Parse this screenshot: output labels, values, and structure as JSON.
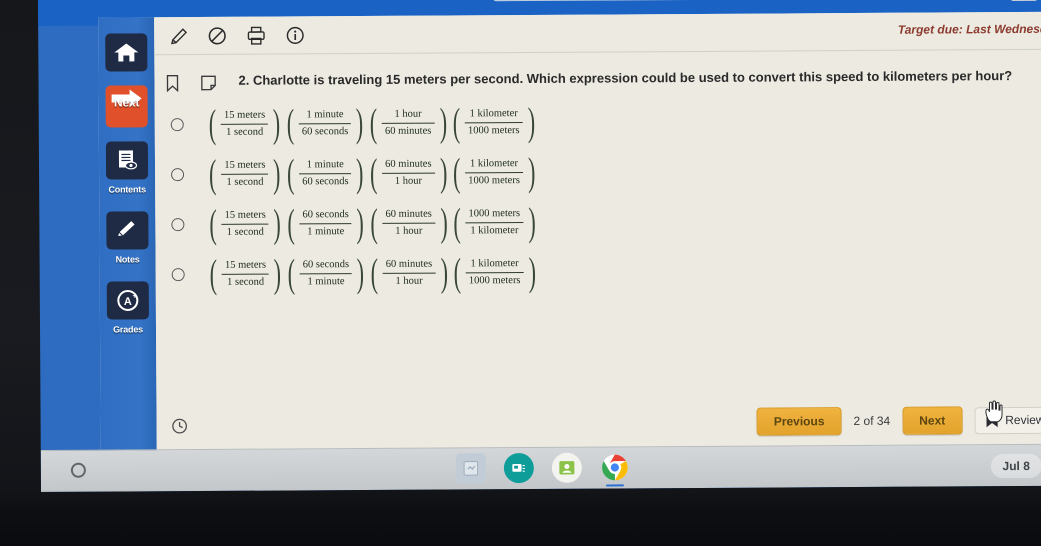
{
  "window": {
    "target_due": "Target due: Last Wednesd"
  },
  "nav_rail": {
    "items": [
      {
        "label": "",
        "icon": "home-icon",
        "name": "home"
      },
      {
        "label": "Next",
        "icon": "arrow-right-icon",
        "name": "next"
      },
      {
        "label": "Contents",
        "icon": "contents-icon",
        "name": "contents"
      },
      {
        "label": "Notes",
        "icon": "pencil-icon",
        "name": "notes"
      },
      {
        "label": "Grades",
        "icon": "grade-a-icon",
        "name": "grades"
      }
    ]
  },
  "toolbar": {
    "tools": [
      {
        "name": "highlighter-icon",
        "title": "Highlighter"
      },
      {
        "name": "strikethrough-icon",
        "title": "Cross out"
      },
      {
        "name": "print-icon",
        "title": "Print"
      },
      {
        "name": "info-icon",
        "title": "Info"
      }
    ]
  },
  "question": {
    "number": "2.",
    "text": "Charlotte is traveling 15 meters per second. Which expression could be used to convert this speed to kilometers per hour?",
    "full_line": "2. Charlotte is traveling 15 meters per second. Which expression could be used to convert this speed to kilometers per hour?",
    "bookmark_icon": "bookmark-icon",
    "note_icon": "note-flag-icon",
    "selected": null
  },
  "choices": [
    {
      "id": "A",
      "selected": false,
      "fractions": [
        {
          "num": "15 meters",
          "den": "1 second"
        },
        {
          "num": "1 minute",
          "den": "60 seconds"
        },
        {
          "num": "1 hour",
          "den": "60 minutes"
        },
        {
          "num": "1 kilometer",
          "den": "1000 meters"
        }
      ]
    },
    {
      "id": "B",
      "selected": false,
      "fractions": [
        {
          "num": "15 meters",
          "den": "1 second"
        },
        {
          "num": "1 minute",
          "den": "60 seconds"
        },
        {
          "num": "60 minutes",
          "den": "1 hour"
        },
        {
          "num": "1 kilometer",
          "den": "1000 meters"
        }
      ]
    },
    {
      "id": "C",
      "selected": false,
      "fractions": [
        {
          "num": "15 meters",
          "den": "1 second"
        },
        {
          "num": "60 seconds",
          "den": "1 minute"
        },
        {
          "num": "60 minutes",
          "den": "1 hour"
        },
        {
          "num": "1000 meters",
          "den": "1 kilometer"
        }
      ]
    },
    {
      "id": "D",
      "selected": false,
      "fractions": [
        {
          "num": "15 meters",
          "den": "1 second"
        },
        {
          "num": "60 seconds",
          "den": "1 minute"
        },
        {
          "num": "60 minutes",
          "den": "1 hour"
        },
        {
          "num": "1 kilometer",
          "den": "1000 meters"
        }
      ]
    }
  ],
  "bottom_bar": {
    "previous_label": "Previous",
    "page_counter": "2 of 34",
    "next_label": "Next",
    "review_label": "Review",
    "clock_icon": "clock-icon",
    "review_icon": "bookmark-filled-icon"
  },
  "shelf": {
    "launcher_icon": "launcher-circle-icon",
    "apps": [
      {
        "name": "files-app-icon",
        "color": "#aebfd0"
      },
      {
        "name": "classroom-app-icon",
        "color": "#0f9d9a"
      },
      {
        "name": "contacts-app-icon",
        "color": "#8bc34a"
      },
      {
        "name": "chrome-app-icon",
        "color": "#4285f4",
        "active": true
      }
    ],
    "tray_date": "Jul 8"
  },
  "colors": {
    "rail_blue": "#2f6ec2",
    "next_orange": "#e0502a",
    "gold_button": "#e3a32c",
    "target_due_red": "#8c3b2e",
    "page_bg": "#eceae1"
  }
}
